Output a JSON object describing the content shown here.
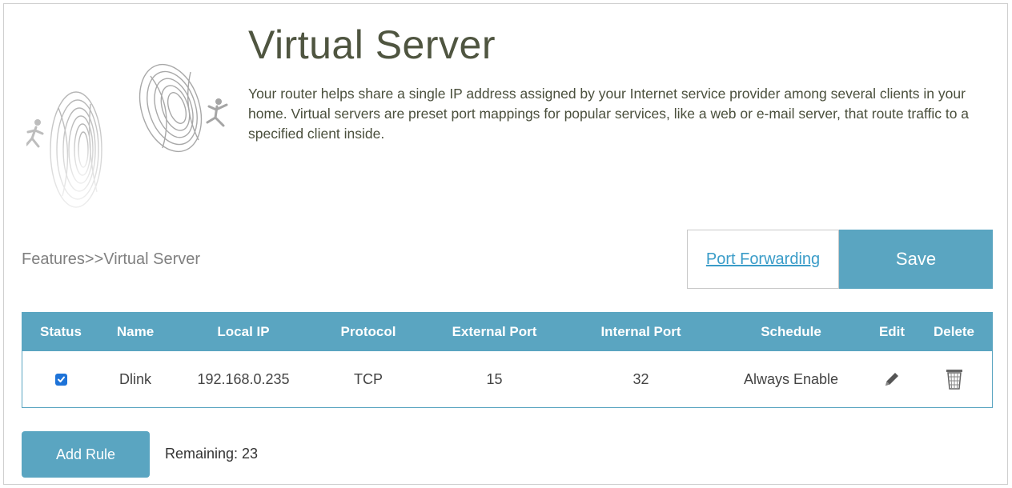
{
  "header": {
    "title": "Virtual Server",
    "description": "Your router helps share a single IP address assigned by your Internet service provider among several clients in your home. Virtual servers are preset port mappings for popular services, like a web or e-mail server, that route traffic to a specified client inside."
  },
  "breadcrumb": "Features>>Virtual Server",
  "actions": {
    "port_forwarding_label": "Port Forwarding",
    "save_label": "Save"
  },
  "table": {
    "columns": [
      "Status",
      "Name",
      "Local IP",
      "Protocol",
      "External Port",
      "Internal Port",
      "Schedule",
      "Edit",
      "Delete"
    ],
    "rows": [
      {
        "status_checked": true,
        "name": "Dlink",
        "local_ip": "192.168.0.235",
        "protocol": "TCP",
        "external_port": "15",
        "internal_port": "32",
        "schedule": "Always Enable",
        "edit_icon": "pencil-icon",
        "delete_icon": "trash-icon"
      }
    ]
  },
  "footer": {
    "add_rule_label": "Add Rule",
    "remaining_text": "Remaining: 23"
  },
  "colors": {
    "accent": "#5aa5c1",
    "link": "#3a9cc8",
    "title": "#4f5540",
    "checkbox": "#1e73d8"
  },
  "icons": {
    "hero": "portal-runner-illustration"
  }
}
